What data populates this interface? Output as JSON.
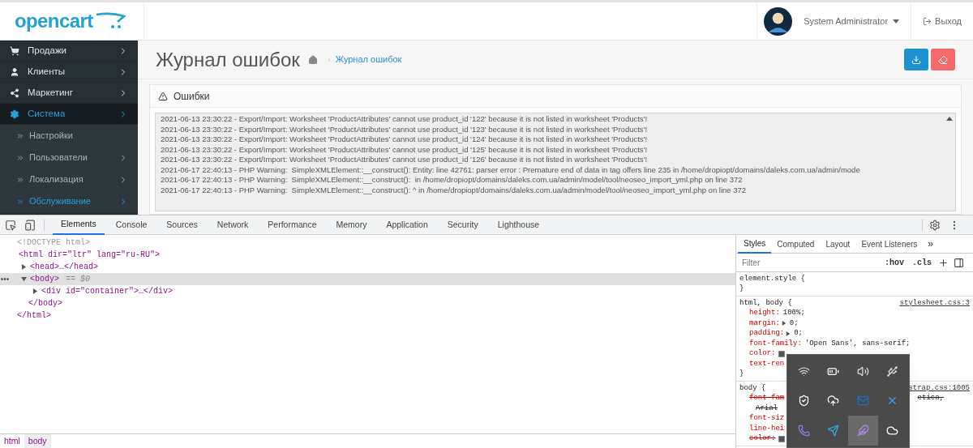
{
  "header": {
    "logo": "opencart",
    "user": {
      "name": "System Administrator"
    },
    "logout": "Выход"
  },
  "sidebar": {
    "items": [
      {
        "label": "Продажи",
        "kind": "cart",
        "selected": false,
        "expandable": true
      },
      {
        "label": "Клиенты",
        "kind": "user",
        "selected": false,
        "expandable": true
      },
      {
        "label": "Маркетинг",
        "kind": "share",
        "selected": false,
        "expandable": true
      },
      {
        "label": "Система",
        "kind": "gear",
        "selected": true,
        "expandable": true,
        "children": [
          {
            "label": "Настройки",
            "selected": false,
            "expandable": false
          },
          {
            "label": "Пользователи",
            "selected": false,
            "expandable": true
          },
          {
            "label": "Локализация",
            "selected": false,
            "expandable": true
          },
          {
            "label": "Обслуживание",
            "selected": true,
            "expandable": true
          }
        ]
      }
    ]
  },
  "content": {
    "title": "Журнал ошибок",
    "breadcrumb": [
      {
        "label": "Журнал ошибок"
      }
    ],
    "actions": [
      {
        "kind": "download",
        "color": "#1e91cf"
      },
      {
        "kind": "clear",
        "color": "#f56b6b"
      }
    ],
    "panel": {
      "title": "Ошибки",
      "log_lines": [
        "2021-06-13 23:30:22 - Export/Import: Worksheet 'ProductAttributes' cannot use product_id '122' because it is not listed in worksheet 'Products'!",
        "2021-06-13 23:30:22 - Export/Import: Worksheet 'ProductAttributes' cannot use product_id '123' because it is not listed in worksheet 'Products'!",
        "2021-06-13 23:30:22 - Export/Import: Worksheet 'ProductAttributes' cannot use product_id '124' because it is not listed in worksheet 'Products'!",
        "2021-06-13 23:30:22 - Export/Import: Worksheet 'ProductAttributes' cannot use product_id '125' because it is not listed in worksheet 'Products'!",
        "2021-06-13 23:30:22 - Export/Import: Worksheet 'ProductAttributes' cannot use product_id '126' because it is not listed in worksheet 'Products'!",
        "2021-06-17 22:40:13 - PHP Warning:  SimpleXMLElement::__construct(): Entity: line 42761: parser error : Premature end of data in tag offers line 235 in /home/dropiopt/domains/daleks.com.ua/admin/mode",
        "2021-06-17 22:40:13 - PHP Warning:  SimpleXMLElement::__construct():  in /home/dropiopt/domains/daleks.com.ua/admin/model/tool/neoseo_import_yml.php on line 372",
        "2021-06-17 22:40:13 - PHP Warning:  SimpleXMLElement::__construct(): ^ in /home/dropiopt/domains/daleks.com.ua/admin/model/tool/neoseo_import_yml.php on line 372"
      ]
    }
  },
  "devtools": {
    "tabs": [
      {
        "label": "Elements",
        "selected": true
      },
      {
        "label": "Console",
        "selected": false
      },
      {
        "label": "Sources",
        "selected": false
      },
      {
        "label": "Network",
        "selected": false
      },
      {
        "label": "Performance",
        "selected": false
      },
      {
        "label": "Memory",
        "selected": false
      },
      {
        "label": "Application",
        "selected": false
      },
      {
        "label": "Security",
        "selected": false
      },
      {
        "label": "Lighthouse",
        "selected": false
      }
    ],
    "dom_tree": [
      {
        "kind": "doctype",
        "text": "<!DOCTYPE html>"
      },
      {
        "kind": "element",
        "open": "<html dir=\"ltr\" lang=\"ru-RU\">",
        "close": "</html>",
        "selected": false,
        "children": [
          {
            "kind": "element",
            "open": "<head>…</head>",
            "expanded": false,
            "selected": false
          },
          {
            "kind": "element",
            "open": "<body>",
            "suffix": "== $0",
            "close": "</body>",
            "expanded": true,
            "selected": true,
            "children": [
              {
                "kind": "element",
                "open": "<div id=\"container\">…</div>",
                "expanded": false,
                "selected": false
              }
            ]
          }
        ]
      }
    ],
    "breadcrumbs": [
      {
        "label": "html",
        "selected": false
      },
      {
        "label": "body",
        "selected": true
      }
    ],
    "styles": {
      "tabs": [
        {
          "label": "Styles",
          "selected": true
        },
        {
          "label": "Computed",
          "selected": false
        },
        {
          "label": "Layout",
          "selected": false
        },
        {
          "label": "Event Listeners",
          "selected": false
        }
      ],
      "more": "»",
      "filter": {
        "placeholder": "Filter"
      },
      "toggles": [
        ":hov",
        ".cls"
      ],
      "rules": [
        {
          "selector": "element.style {",
          "close": "}"
        },
        {
          "selector": "html, body {",
          "source": "stylesheet.css:3",
          "close": "}",
          "declarations": [
            {
              "kind": "decl",
              "name": "height:",
              "value": "100%;",
              "overridden": false
            },
            {
              "kind": "decl",
              "name": "margin:",
              "value": "0;",
              "expandable": true,
              "overridden": false
            },
            {
              "kind": "decl",
              "name": "padding:",
              "value": "0;",
              "expandable": true,
              "overridden": false
            },
            {
              "kind": "decl",
              "name": "font-family:",
              "value": "'Open Sans', sans-serif;",
              "overridden": false
            },
            {
              "kind": "decl",
              "name": "color:",
              "swatch": true,
              "overridden": false
            },
            {
              "kind": "decl",
              "name": "text-ren",
              "overridden": false
            }
          ]
        },
        {
          "selector": "body {",
          "source": "strap.css:1005",
          "declarations": [
            {
              "kind": "decl",
              "name": "font-fam",
              "after_overlay": "etica,",
              "overridden": true
            },
            {
              "kind": "continuation",
              "value": "Arial",
              "overridden": true
            },
            {
              "kind": "decl",
              "name": "font-siz",
              "overridden": false
            },
            {
              "kind": "decl",
              "name": "line-hei",
              "overridden": false
            },
            {
              "kind": "decl",
              "name": "color:",
              "swatch": true,
              "overridden": true
            }
          ]
        }
      ]
    }
  },
  "tray": {
    "items": [
      {
        "kind": "wifi",
        "selected": false
      },
      {
        "kind": "battery",
        "selected": false
      },
      {
        "kind": "speaker",
        "selected": false
      },
      {
        "kind": "usb",
        "selected": false
      },
      {
        "kind": "shield",
        "selected": false
      },
      {
        "kind": "cloud-upload",
        "selected": false
      },
      {
        "kind": "mail",
        "selected": false
      },
      {
        "kind": "cross",
        "selected": false
      },
      {
        "kind": "phone",
        "selected": false
      },
      {
        "kind": "send",
        "selected": false
      },
      {
        "kind": "feather",
        "selected": true
      },
      {
        "kind": "cloud",
        "selected": false
      }
    ]
  }
}
